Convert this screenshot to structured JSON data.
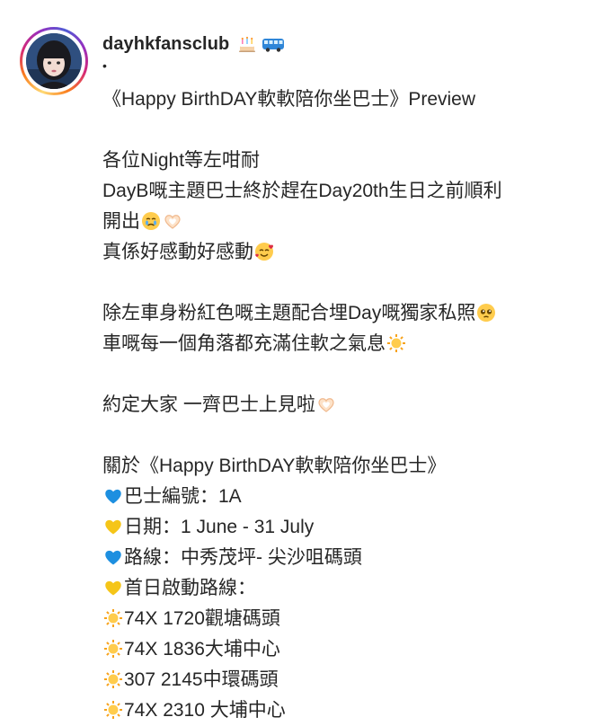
{
  "post": {
    "username": "dayhkfansclub",
    "header_icons": [
      "birthday-cake-icon",
      "bus-icon"
    ],
    "separator": "•",
    "caption_lines": [
      {
        "text": "《Happy BirthDAY軟軟陪你坐巴士》Preview",
        "icons": []
      },
      {
        "text": "",
        "icons": []
      },
      {
        "text": "各位Night等左咁耐",
        "icons": []
      },
      {
        "text": "DayB嘅主題巴士終於趕在Day20th生日之前順利",
        "icons": []
      },
      {
        "text": "開出",
        "icons": [
          "crying-face-icon",
          "heart-hands-icon"
        ]
      },
      {
        "text": "真係好感動好感動",
        "icons": [
          "smiling-face-with-hearts-icon"
        ]
      },
      {
        "text": "",
        "icons": []
      },
      {
        "text": "除左車身粉紅色嘅主題配合埋Day嘅獨家私照",
        "icons": [
          "pleading-face-icon"
        ]
      },
      {
        "text": "車嘅每一個角落都充滿住軟之氣息",
        "icons": [
          "sun-icon"
        ]
      },
      {
        "text": "",
        "icons": []
      },
      {
        "text": "約定大家 一齊巴士上見啦",
        "icons": [
          "heart-hands-icon"
        ]
      },
      {
        "text": "",
        "icons": []
      },
      {
        "text": "關於《Happy BirthDAY軟軟陪你坐巴士》",
        "icons": []
      },
      {
        "prefix_icon": "blue-heart-icon",
        "text": "巴士編號：1A",
        "icons": []
      },
      {
        "prefix_icon": "yellow-heart-icon",
        "text": "日期：1 June - 31 July",
        "icons": []
      },
      {
        "prefix_icon": "blue-heart-icon",
        "text": "路線：中秀茂坪- 尖沙咀碼頭",
        "icons": []
      },
      {
        "prefix_icon": "yellow-heart-icon",
        "text": "首日啟動路線：",
        "icons": []
      },
      {
        "prefix_icon": "sun-icon",
        "text": "74X 1720觀塘碼頭",
        "icons": []
      },
      {
        "prefix_icon": "sun-icon",
        "text": "74X 1836大埔中心",
        "icons": []
      },
      {
        "prefix_icon": "sun-icon",
        "text": "307 2145中環碼頭",
        "icons": []
      },
      {
        "prefix_icon": "sun-icon",
        "text": "74X 2310 大埔中心",
        "icons": []
      }
    ]
  },
  "colors": {
    "text": "#262626",
    "blue_heart": "#1d8fe0",
    "yellow_heart": "#f5c518",
    "sun": "#f7a21b"
  }
}
